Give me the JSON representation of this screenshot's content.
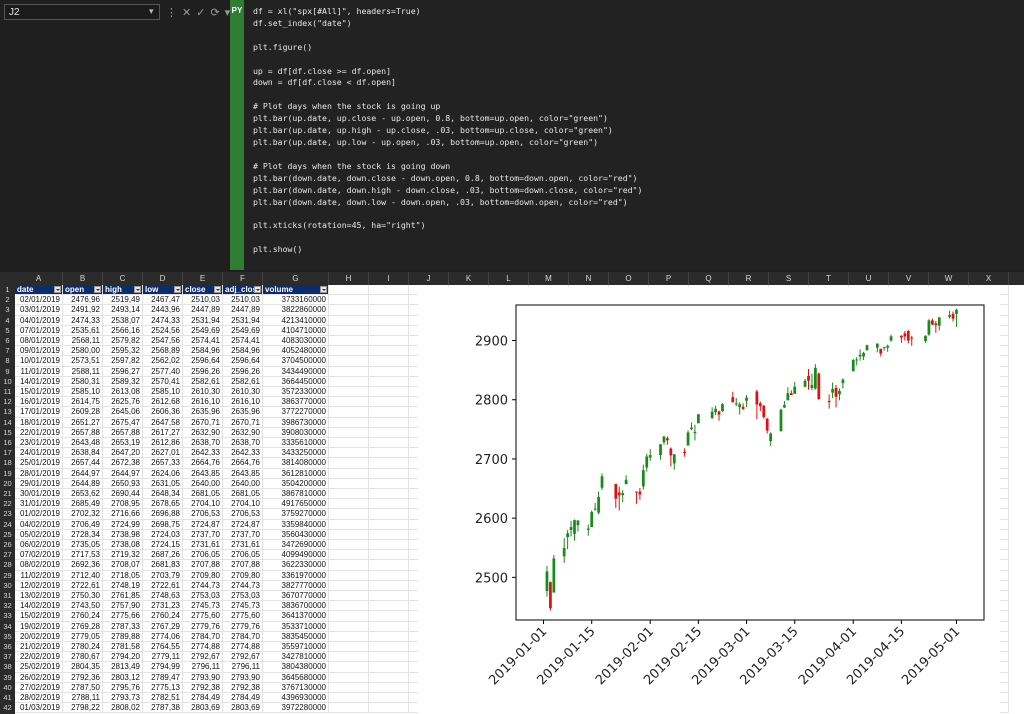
{
  "namebox": {
    "value": "J2"
  },
  "formula_bar": {
    "py_label": "PY"
  },
  "code_lines": [
    "df = xl(\"spx[#All]\", headers=True)",
    "df.set_index(\"date\")",
    "",
    "plt.figure()",
    "",
    "up = df[df.close >= df.open]",
    "down = df[df.close < df.open]",
    "",
    "# Plot days when the stock is going up",
    "plt.bar(up.date, up.close - up.open, 0.8, bottom=up.open, color=\"green\")",
    "plt.bar(up.date, up.high - up.close, .03, bottom=up.close, color=\"green\")",
    "plt.bar(up.date, up.low - up.open, .03, bottom=up.open, color=\"green\")",
    "",
    "# Plot days when the stock is going down",
    "plt.bar(down.date, down.close - down.open, 0.8, bottom=down.open, color=\"red\")",
    "plt.bar(down.date, down.high - down.close, .03, bottom=down.close, color=\"red\")",
    "plt.bar(down.date, down.low - down.open, .03, bottom=down.open, color=\"red\")",
    "",
    "plt.xticks(rotation=45, ha=\"right\")",
    "",
    "plt.show()"
  ],
  "columns": [
    "A",
    "B",
    "C",
    "D",
    "E",
    "F",
    "G",
    "H",
    "I",
    "J",
    "K",
    "L",
    "M",
    "N",
    "O",
    "P",
    "Q",
    "R",
    "S",
    "T",
    "U",
    "V",
    "W",
    "X"
  ],
  "table_headers": [
    "date",
    "open",
    "high",
    "low",
    "close",
    "adj_close",
    "volume"
  ],
  "rows": [
    [
      "02/01/2019",
      "2476,96",
      "2519,49",
      "2467,47",
      "2510,03",
      "2510,03",
      "3733160000"
    ],
    [
      "03/01/2019",
      "2491,92",
      "2493,14",
      "2443,96",
      "2447,89",
      "2447,89",
      "3822860000"
    ],
    [
      "04/01/2019",
      "2474,33",
      "2538,07",
      "2474,33",
      "2531,94",
      "2531,94",
      "4213410000"
    ],
    [
      "07/01/2019",
      "2535,61",
      "2566,16",
      "2524,56",
      "2549,69",
      "2549,69",
      "4104710000"
    ],
    [
      "08/01/2019",
      "2568,11",
      "2579,82",
      "2547,56",
      "2574,41",
      "2574,41",
      "4083030000"
    ],
    [
      "09/01/2019",
      "2580,00",
      "2595,32",
      "2568,89",
      "2584,96",
      "2584,96",
      "4052480000"
    ],
    [
      "10/01/2019",
      "2573,51",
      "2597,82",
      "2562,02",
      "2596,64",
      "2596,64",
      "3704500000"
    ],
    [
      "11/01/2019",
      "2588,11",
      "2596,27",
      "2577,40",
      "2596,26",
      "2596,26",
      "3434490000"
    ],
    [
      "14/01/2019",
      "2580,31",
      "2589,32",
      "2570,41",
      "2582,61",
      "2582,61",
      "3664450000"
    ],
    [
      "15/01/2019",
      "2585,10",
      "2613,08",
      "2585,10",
      "2610,30",
      "2610,30",
      "3572330000"
    ],
    [
      "16/01/2019",
      "2614,75",
      "2625,76",
      "2612,68",
      "2616,10",
      "2616,10",
      "3863770000"
    ],
    [
      "17/01/2019",
      "2609,28",
      "2645,06",
      "2606,36",
      "2635,96",
      "2635,96",
      "3772270000"
    ],
    [
      "18/01/2019",
      "2651,27",
      "2675,47",
      "2647,58",
      "2670,71",
      "2670,71",
      "3986730000"
    ],
    [
      "22/01/2019",
      "2657,88",
      "2657,88",
      "2617,27",
      "2632,90",
      "2632,90",
      "3908030000"
    ],
    [
      "23/01/2019",
      "2643,48",
      "2653,19",
      "2612,86",
      "2638,70",
      "2638,70",
      "3335610000"
    ],
    [
      "24/01/2019",
      "2638,84",
      "2647,20",
      "2627,01",
      "2642,33",
      "2642,33",
      "3433250000"
    ],
    [
      "25/01/2019",
      "2657,44",
      "2672,38",
      "2657,33",
      "2664,76",
      "2664,76",
      "3814080000"
    ],
    [
      "28/01/2019",
      "2644,97",
      "2644,97",
      "2624,06",
      "2643,85",
      "2643,85",
      "3612810000"
    ],
    [
      "29/01/2019",
      "2644,89",
      "2650,93",
      "2631,05",
      "2640,00",
      "2640,00",
      "3504200000"
    ],
    [
      "30/01/2019",
      "2653,62",
      "2690,44",
      "2648,34",
      "2681,05",
      "2681,05",
      "3867810000"
    ],
    [
      "31/01/2019",
      "2685,49",
      "2708,95",
      "2678,65",
      "2704,10",
      "2704,10",
      "4917650000"
    ],
    [
      "01/02/2019",
      "2702,32",
      "2716,66",
      "2696,88",
      "2706,53",
      "2706,53",
      "3759270000"
    ],
    [
      "04/02/2019",
      "2706,49",
      "2724,99",
      "2698,75",
      "2724,87",
      "2724,87",
      "3359840000"
    ],
    [
      "05/02/2019",
      "2728,34",
      "2738,98",
      "2724,03",
      "2737,70",
      "2737,70",
      "3560430000"
    ],
    [
      "06/02/2019",
      "2735,05",
      "2738,08",
      "2724,15",
      "2731,61",
      "2731,61",
      "3472690000"
    ],
    [
      "07/02/2019",
      "2717,53",
      "2719,32",
      "2687,26",
      "2706,05",
      "2706,05",
      "4099490000"
    ],
    [
      "08/02/2019",
      "2692,36",
      "2708,07",
      "2681,83",
      "2707,88",
      "2707,88",
      "3622330000"
    ],
    [
      "11/02/2019",
      "2712,40",
      "2718,05",
      "2703,79",
      "2709,80",
      "2709,80",
      "3361970000"
    ],
    [
      "12/02/2019",
      "2722,61",
      "2748,19",
      "2722,61",
      "2744,73",
      "2744,73",
      "3827770000"
    ],
    [
      "13/02/2019",
      "2750,30",
      "2761,85",
      "2748,63",
      "2753,03",
      "2753,03",
      "3670770000"
    ],
    [
      "14/02/2019",
      "2743,50",
      "2757,90",
      "2731,23",
      "2745,73",
      "2745,73",
      "3836700000"
    ],
    [
      "15/02/2019",
      "2760,24",
      "2775,66",
      "2760,24",
      "2775,60",
      "2775,60",
      "3641370000"
    ],
    [
      "19/02/2019",
      "2769,28",
      "2787,33",
      "2767,29",
      "2779,76",
      "2779,76",
      "3533710000"
    ],
    [
      "20/02/2019",
      "2779,05",
      "2789,88",
      "2774,06",
      "2784,70",
      "2784,70",
      "3835450000"
    ],
    [
      "21/02/2019",
      "2780,24",
      "2781,58",
      "2764,55",
      "2774,88",
      "2774,88",
      "3559710000"
    ],
    [
      "22/02/2019",
      "2780,67",
      "2794,20",
      "2779,11",
      "2792,67",
      "2792,67",
      "3427810000"
    ],
    [
      "25/02/2019",
      "2804,35",
      "2813,49",
      "2794,99",
      "2796,11",
      "2796,11",
      "3804380000"
    ],
    [
      "26/02/2019",
      "2792,36",
      "2803,12",
      "2789,47",
      "2793,90",
      "2793,90",
      "3645680000"
    ],
    [
      "27/02/2019",
      "2787,50",
      "2795,76",
      "2775,13",
      "2792,38",
      "2792,38",
      "3767130000"
    ],
    [
      "28/02/2019",
      "2788,11",
      "2793,73",
      "2782,51",
      "2784,49",
      "2784,49",
      "4396930000"
    ],
    [
      "01/03/2019",
      "2798,22",
      "2808,02",
      "2787,38",
      "2803,69",
      "2803,69",
      "3972280000"
    ]
  ],
  "colors": {
    "up": "#1a8a1a",
    "down": "#e01010",
    "header_bg": "#0d2c6c",
    "py_green": "#2e7d32"
  },
  "chart_data": {
    "type": "candlestick",
    "x_ticks": [
      "2019-01-01",
      "2019-01-15",
      "2019-02-01",
      "2019-02-15",
      "2019-03-01",
      "2019-03-15",
      "2019-04-01",
      "2019-04-15",
      "2019-05-01"
    ],
    "y_ticks": [
      2500,
      2600,
      2700,
      2800,
      2900
    ],
    "ylim": [
      2428,
      2960
    ],
    "xlim": [
      "2018-12-24",
      "2019-05-09"
    ],
    "grid": false,
    "series": [
      {
        "color": "green",
        "candles": [
          [
            "2019-01-02",
            2476.96,
            2519.49,
            2467.47,
            2510.03
          ],
          [
            "2019-01-04",
            2474.33,
            2538.07,
            2474.33,
            2531.94
          ],
          [
            "2019-01-07",
            2535.61,
            2566.16,
            2524.56,
            2549.69
          ],
          [
            "2019-01-08",
            2568.11,
            2579.82,
            2547.56,
            2574.41
          ],
          [
            "2019-01-09",
            2580.0,
            2595.32,
            2568.89,
            2584.96
          ],
          [
            "2019-01-10",
            2573.51,
            2597.82,
            2562.02,
            2596.64
          ],
          [
            "2019-01-11",
            2588.11,
            2596.27,
            2577.4,
            2596.26
          ],
          [
            "2019-01-14",
            2580.31,
            2589.32,
            2570.41,
            2582.61
          ],
          [
            "2019-01-15",
            2585.1,
            2613.08,
            2585.1,
            2610.3
          ],
          [
            "2019-01-16",
            2614.75,
            2625.76,
            2612.68,
            2616.1
          ],
          [
            "2019-01-17",
            2609.28,
            2645.06,
            2606.36,
            2635.96
          ],
          [
            "2019-01-18",
            2651.27,
            2675.47,
            2647.58,
            2670.71
          ],
          [
            "2019-01-24",
            2638.84,
            2647.2,
            2627.01,
            2642.33
          ],
          [
            "2019-01-25",
            2657.44,
            2672.38,
            2657.33,
            2664.76
          ],
          [
            "2019-01-30",
            2653.62,
            2690.44,
            2648.34,
            2681.05
          ],
          [
            "2019-01-31",
            2685.49,
            2708.95,
            2678.65,
            2704.1
          ],
          [
            "2019-02-01",
            2702.32,
            2716.66,
            2696.88,
            2706.53
          ],
          [
            "2019-02-04",
            2706.49,
            2724.99,
            2698.75,
            2724.87
          ],
          [
            "2019-02-05",
            2728.34,
            2738.98,
            2724.03,
            2737.7
          ],
          [
            "2019-02-08",
            2692.36,
            2708.07,
            2681.83,
            2707.88
          ],
          [
            "2019-02-12",
            2722.61,
            2748.19,
            2722.61,
            2744.73
          ],
          [
            "2019-02-13",
            2750.3,
            2761.85,
            2748.63,
            2753.03
          ],
          [
            "2019-02-14",
            2743.5,
            2757.9,
            2731.23,
            2745.73
          ],
          [
            "2019-02-15",
            2760.24,
            2775.66,
            2760.24,
            2775.6
          ],
          [
            "2019-02-19",
            2769.28,
            2787.33,
            2767.29,
            2779.76
          ],
          [
            "2019-02-20",
            2779.05,
            2789.88,
            2774.06,
            2784.7
          ],
          [
            "2019-02-22",
            2780.67,
            2794.2,
            2779.11,
            2792.67
          ],
          [
            "2019-02-26",
            2792.36,
            2803.12,
            2789.47,
            2793.9
          ],
          [
            "2019-02-27",
            2787.5,
            2795.76,
            2775.13,
            2792.38
          ],
          [
            "2019-03-01",
            2798.22,
            2808.02,
            2787.38,
            2803.69
          ],
          [
            "2019-03-08",
            2730,
            2745,
            2722,
            2743
          ],
          [
            "2019-03-11",
            2747,
            2785,
            2746,
            2783
          ],
          [
            "2019-03-12",
            2787,
            2798,
            2786,
            2791
          ],
          [
            "2019-03-13",
            2799,
            2821,
            2799,
            2811
          ],
          [
            "2019-03-15",
            2810,
            2830,
            2810,
            2822
          ],
          [
            "2019-03-18",
            2822,
            2835,
            2821,
            2832
          ],
          [
            "2019-03-20",
            2820,
            2844,
            2816,
            2825
          ],
          [
            "2019-03-21",
            2819,
            2860,
            2817,
            2854
          ],
          [
            "2019-03-26",
            2812,
            2829,
            2803,
            2818
          ],
          [
            "2019-03-28",
            2809,
            2819,
            2799,
            2815
          ],
          [
            "2019-03-29",
            2828,
            2836,
            2819,
            2834
          ],
          [
            "2019-04-01",
            2848,
            2869,
            2848,
            2867
          ],
          [
            "2019-04-02",
            2868,
            2872,
            2858,
            2867
          ],
          [
            "2019-04-03",
            2876,
            2885,
            2866,
            2873
          ],
          [
            "2019-04-04",
            2873,
            2881,
            2867,
            2879
          ],
          [
            "2019-04-05",
            2884,
            2893,
            2882,
            2892
          ],
          [
            "2019-04-08",
            2888,
            2895,
            2880,
            2895
          ],
          [
            "2019-04-10",
            2889,
            2889,
            2883,
            2888
          ],
          [
            "2019-04-11",
            2891,
            2893,
            2881,
            2888
          ],
          [
            "2019-04-12",
            2900,
            2910,
            2898,
            2907
          ],
          [
            "2019-04-22",
            2899,
            2909,
            2896,
            2908
          ],
          [
            "2019-04-23",
            2910,
            2936,
            2908,
            2934
          ],
          [
            "2019-04-26",
            2925,
            2940,
            2917,
            2939
          ],
          [
            "2019-04-29",
            2940,
            2950,
            2937,
            2943
          ],
          [
            "2019-05-01",
            2952,
            2954,
            2923,
            2945
          ]
        ]
      },
      {
        "color": "red",
        "candles": [
          [
            "2019-01-03",
            2491.92,
            2493.14,
            2443.96,
            2447.89
          ],
          [
            "2019-01-22",
            2657.88,
            2657.88,
            2617.27,
            2632.9
          ],
          [
            "2019-01-23",
            2643.48,
            2653.19,
            2612.86,
            2638.7
          ],
          [
            "2019-01-28",
            2644.97,
            2644.97,
            2624.06,
            2643.85
          ],
          [
            "2019-01-29",
            2644.89,
            2650.93,
            2631.05,
            2640.0
          ],
          [
            "2019-02-06",
            2735.05,
            2738.08,
            2724.15,
            2731.61
          ],
          [
            "2019-02-07",
            2717.53,
            2719.32,
            2687.26,
            2706.05
          ],
          [
            "2019-02-11",
            2712.4,
            2718.05,
            2703.79,
            2709.8
          ],
          [
            "2019-02-21",
            2780.24,
            2781.58,
            2764.55,
            2774.88
          ],
          [
            "2019-02-25",
            2804.35,
            2813.49,
            2794.99,
            2796.11
          ],
          [
            "2019-02-28",
            2788.11,
            2793.73,
            2782.51,
            2784.49
          ],
          [
            "2019-03-04",
            2814,
            2817,
            2767,
            2792
          ],
          [
            "2019-03-05",
            2794,
            2797,
            2781,
            2789
          ],
          [
            "2019-03-06",
            2790,
            2791,
            2768,
            2771
          ],
          [
            "2019-03-07",
            2768,
            2769,
            2743,
            2748
          ],
          [
            "2019-03-14",
            2811,
            2816,
            2808,
            2808
          ],
          [
            "2019-03-19",
            2840,
            2852,
            2817,
            2832
          ],
          [
            "2019-03-22",
            2844,
            2846,
            2800,
            2801
          ],
          [
            "2019-03-25",
            2796,
            2809,
            2785,
            2798
          ],
          [
            "2019-03-27",
            2820,
            2825,
            2787,
            2805
          ],
          [
            "2019-04-09",
            2886,
            2886,
            2873,
            2878
          ],
          [
            "2019-04-15",
            2908,
            2909,
            2896,
            2905
          ],
          [
            "2019-04-16",
            2912,
            2916,
            2900,
            2907
          ],
          [
            "2019-04-17",
            2916,
            2918,
            2895,
            2900
          ],
          [
            "2019-04-18",
            2904,
            2908,
            2891,
            2905
          ],
          [
            "2019-04-24",
            2934,
            2937,
            2926,
            2927
          ],
          [
            "2019-04-25",
            2929,
            2933,
            2913,
            2926
          ],
          [
            "2019-04-30",
            2937,
            2949,
            2932,
            2945
          ]
        ]
      }
    ]
  }
}
